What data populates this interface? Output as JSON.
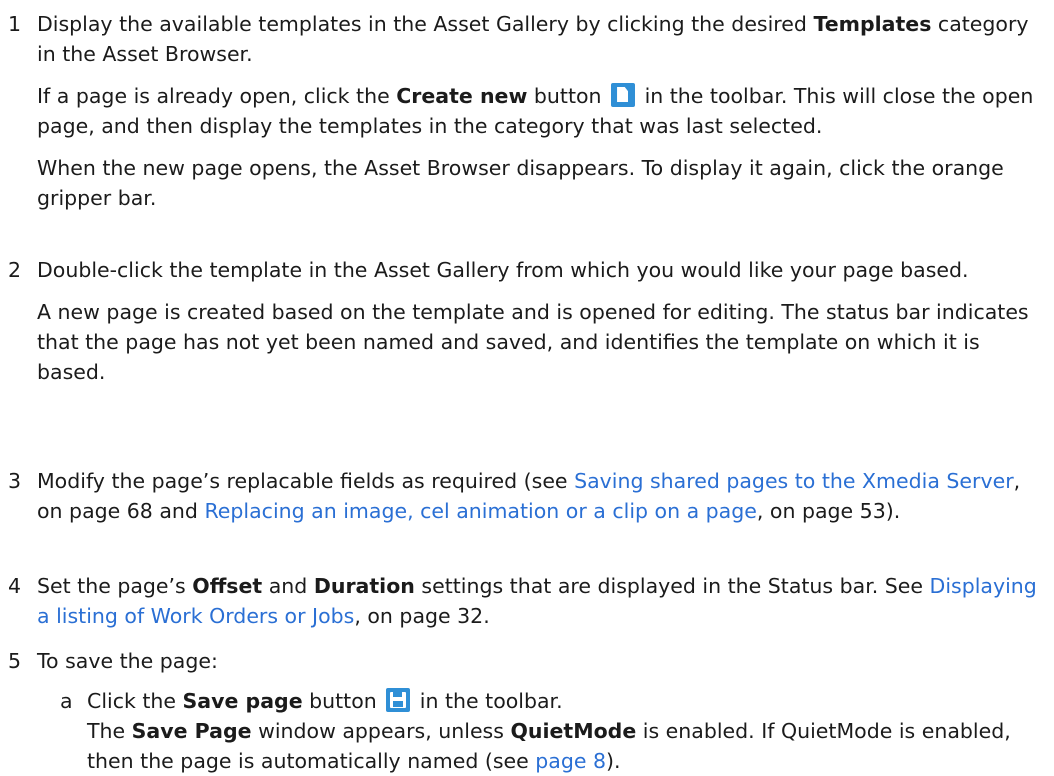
{
  "steps": [
    {
      "num": "1",
      "p1_a": "Display the available templates in the Asset Gallery by clicking the desired ",
      "p1_b": "Templates",
      "p1_c": " category in the Asset Browser.",
      "p2_a": "If a page is already open, click the ",
      "p2_b": "Create new",
      "p2_c": " button ",
      "p2_d": " in the toolbar. This will close the open page, and then display the templates in the category that was last selected.",
      "p3": "When the new page opens, the Asset Browser disappears. To display it again, click the orange gripper bar."
    },
    {
      "num": "2",
      "p1": "Double-click the template in the Asset Gallery from which you would like your page based.",
      "p2": "A new page is created based on the template and is opened for editing. The status bar indicates that the page has not yet been named and saved, and identifies the template on which it is based."
    },
    {
      "num": "3",
      "t1": "Modify the page’s replacable fields as required (see ",
      "link1": "Saving shared pages to the Xmedia Server",
      "t2": ", on page 68 and ",
      "link2": "Replacing an image, cel animation or a clip on a page",
      "t3": ", on page 53)."
    },
    {
      "num": "4",
      "t1": "Set the page’s ",
      "b1": "Offset",
      "t2": " and ",
      "b2": "Duration",
      "t3": " settings that are displayed in the Status bar. See ",
      "link1": "Displaying a listing of Work Orders or Jobs",
      "t4": ", on page 32."
    },
    {
      "num": "5",
      "t1": "To save the page:",
      "sub": {
        "letter": "a",
        "t1": "Click the ",
        "b1": "Save page",
        "t2": " button ",
        "t3": " in the toolbar.",
        "line2_a": "The ",
        "line2_b": "Save Page",
        "line2_c": " window appears, unless ",
        "line2_d": "QuietMode",
        "line2_e": " is enabled. If QuietMode is enabled, then the page is automatically named (see ",
        "line2_link": "page 8",
        "line2_f": ")."
      }
    }
  ],
  "icons": {
    "create_new": "create-new-page-icon",
    "save_page": "save-page-icon",
    "color": "#2f8fd6"
  },
  "link_color": "#2a6fd4"
}
